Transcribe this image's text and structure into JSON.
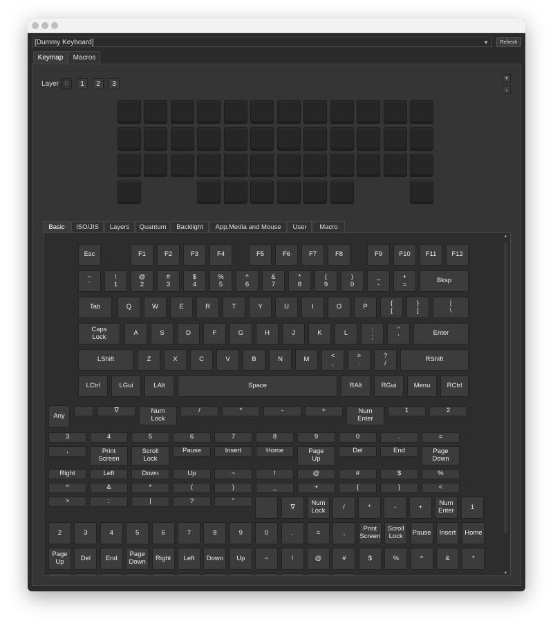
{
  "combo": {
    "value": "[Dummy Keyboard]"
  },
  "refresh_label": "Refresh",
  "top_tabs": [
    "Keymap",
    "Macros"
  ],
  "layer": {
    "label": "Layer",
    "buttons": [
      "0",
      "1",
      "2",
      "3"
    ],
    "selected": "0"
  },
  "layer_controls": {
    "plus": "+",
    "minus": "-"
  },
  "bottom_tabs": [
    "Basic",
    "ISO/JIS",
    "Layers",
    "Quantum",
    "Backlight",
    "App,Media and Mouse",
    "User",
    "Macro"
  ],
  "keyboard": {
    "row0": [
      "Esc",
      "F1",
      "F2",
      "F3",
      "F4",
      "F5",
      "F6",
      "F7",
      "F8",
      "F9",
      "F10",
      "F11",
      "F12"
    ],
    "row1": [
      "~\n`",
      "!\n1",
      "@\n2",
      "#\n3",
      "$\n4",
      "%\n5",
      "^\n6",
      "&\n7",
      "*\n8",
      "(\n9",
      ")\n0",
      "_\n-",
      "+\n=",
      "Bksp"
    ],
    "row2": [
      "Tab",
      "Q",
      "W",
      "E",
      "R",
      "T",
      "Y",
      "U",
      "I",
      "O",
      "P",
      "{\n[",
      "}\n]",
      "|\n\\"
    ],
    "row3": [
      "Caps\nLock",
      "A",
      "S",
      "D",
      "F",
      "G",
      "H",
      "J",
      "K",
      "L",
      ":\n;",
      "\"\n'",
      "Enter"
    ],
    "row4": [
      "LShift",
      "Z",
      "X",
      "C",
      "V",
      "B",
      "N",
      "M",
      "<\n,",
      ">\n.",
      "?\n/",
      "RShift"
    ],
    "row5": [
      "LCtrl",
      "LGui",
      "LAlt",
      "Space",
      "RAlt",
      "RGui",
      "Menu",
      "RCtrl"
    ]
  },
  "any_label": "Any",
  "keypad_small": {
    "r1": [
      "",
      "∇",
      "Num\nLock",
      "/",
      "*",
      "-",
      "+",
      "Num\nEnter",
      "1",
      "2"
    ],
    "r2": [
      "3",
      "4",
      "5",
      "6",
      "7",
      "8",
      "9",
      "0",
      ".",
      "="
    ],
    "r3": [
      ",",
      "Print\nScreen",
      "Scroll\nLock",
      "Pause",
      "Insert",
      "Home",
      "Page\nUp",
      "Del",
      "End",
      "Page\nDown"
    ],
    "r4": [
      "Right",
      "Left",
      "Down",
      "Up",
      "~",
      "!",
      "@",
      "#",
      "$",
      "%"
    ],
    "r5": [
      "^",
      "&",
      "*",
      "(",
      ")",
      "_",
      "+",
      "{",
      "}",
      "<"
    ],
    "r6": [
      ">",
      ":",
      "|",
      "?",
      "\""
    ]
  },
  "keypad_mid": {
    "r6_right": [
      "",
      "∇",
      "Num\nLock",
      "/",
      "*",
      "-",
      "+",
      "Num\nEnter",
      "1"
    ],
    "r7": [
      "2",
      "3",
      "4",
      "5",
      "6",
      "7",
      "8",
      "9",
      "0",
      ".",
      "=",
      ",",
      "Print\nScreen",
      "Scroll\nLock",
      "Pause",
      "Insert",
      "Home"
    ],
    "r8": [
      "Page\nUp",
      "Del",
      "End",
      "Page\nDown",
      "Right",
      "Left",
      "Down",
      "Up",
      "~",
      "!",
      "@",
      "#",
      "$",
      "%",
      "^",
      "&",
      "*"
    ]
  }
}
